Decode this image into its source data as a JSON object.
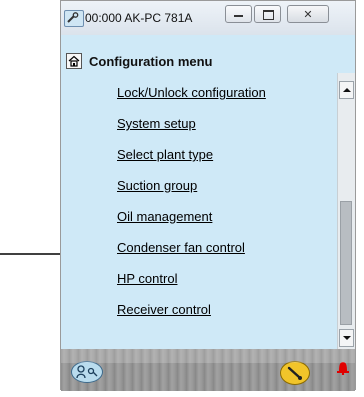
{
  "window": {
    "title": "00:000 AK-PC 781A"
  },
  "header": {
    "title": "Configuration menu"
  },
  "menu": {
    "items": [
      {
        "label": "Lock/Unlock configuration"
      },
      {
        "label": "System setup"
      },
      {
        "label": "Select plant type"
      },
      {
        "label": "Suction group"
      },
      {
        "label": "Oil management"
      },
      {
        "label": "Condenser fan control"
      },
      {
        "label": "HP control"
      },
      {
        "label": "Receiver control"
      }
    ]
  },
  "icons": {
    "app": "wrench-window-icon",
    "home": "home-icon",
    "user": "user-login-icon",
    "service": "wrench-icon",
    "alarm": "alarm-bell-icon",
    "pointer": "arrow-right-icon"
  },
  "colors": {
    "content_bg": "#cfe9f7",
    "alarm": "#e00000",
    "service": "#f1c42a"
  }
}
